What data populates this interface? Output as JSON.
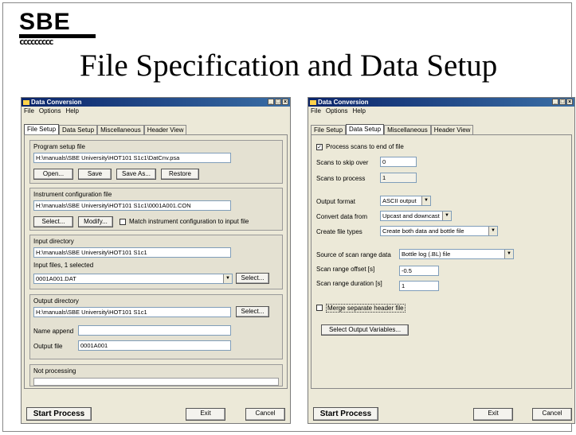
{
  "logo": {
    "text": "SBE",
    "wave": "ccccccccc"
  },
  "slide_title": "File Specification and Data Setup",
  "left_window": {
    "title": "Data Conversion",
    "menu": [
      "File",
      "Options",
      "Help"
    ],
    "tabs": [
      "File Setup",
      "Data Setup",
      "Miscellaneous",
      "Header View"
    ],
    "active_tab": "File Setup",
    "program_setup": {
      "label": "Program setup file",
      "path": "H:\\manuals\\SBE University\\HOT101 S1c1\\DatCnv.psa",
      "buttons": [
        "Open...",
        "Save",
        "Save As...",
        "Restore"
      ]
    },
    "instrument_config": {
      "label": "Instrument configuration file",
      "path": "H:\\manuals\\SBE University\\HOT101 S1c1\\0001A001.CON",
      "select_label": "Select...",
      "modify_label": "Modify...",
      "match_label": "Match instrument configuration to input file",
      "match_checked": false
    },
    "input_directory": {
      "label": "Input directory",
      "path": "H:\\manuals\\SBE University\\HOT101 S1c1",
      "files_label": "Input files, 1 selected",
      "file_value": "0001A001.DAT",
      "select_label": "Select..."
    },
    "output_directory": {
      "label": "Output directory",
      "path": "H:\\manuals\\SBE University\\HOT101 S1c1",
      "select_label": "Select...",
      "name_append_label": "Name append",
      "name_append_value": "",
      "output_file_label": "Output file",
      "output_file_value": "0001A001"
    },
    "status": {
      "text": "Not processing",
      "progress": 0
    },
    "start_label": "Start Process",
    "exit_label": "Exit",
    "cancel_label": "Cancel"
  },
  "right_window": {
    "title": "Data Conversion",
    "menu": [
      "File",
      "Options",
      "Help"
    ],
    "tabs": [
      "File Setup",
      "Data Setup",
      "Miscellaneous",
      "Header View"
    ],
    "active_tab": "Data Setup",
    "process_scans_label": "Process scans to end of file",
    "process_scans_checked": true,
    "skip_over_label": "Scans to skip over",
    "skip_over_value": "0",
    "scans_to_process_label": "Scans to process",
    "scans_to_process_value": "1",
    "output_format_label": "Output format",
    "output_format_value": "ASCII output",
    "convert_from_label": "Convert data from",
    "convert_from_value": "Upcast and downcast",
    "create_file_types_label": "Create file types",
    "create_file_types_value": "Create both data and bottle file",
    "source_scan_range_label": "Source of scan range data",
    "source_scan_range_value": "Bottle log (.BL) file",
    "scan_range_offset_label": "Scan range offset [s]",
    "scan_range_offset_value": "-0.5",
    "scan_range_duration_label": "Scan range duration [s]",
    "scan_range_duration_value": "1",
    "merge_header_label": "Merge separate header file",
    "merge_header_checked": false,
    "select_output_vars_label": "Select Output Variables...",
    "start_label": "Start Process",
    "exit_label": "Exit",
    "cancel_label": "Cancel"
  }
}
